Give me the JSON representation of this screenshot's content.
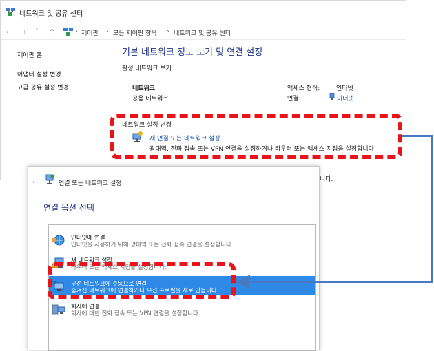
{
  "window1": {
    "title": "네트워크 및 공유 센터",
    "nav": {
      "back": "←",
      "forward": "→",
      "recent": "˅",
      "up": "↑"
    },
    "breadcrumb": [
      "제어판",
      "모든 제어판 항목",
      "네트워크 및 공유 센터"
    ],
    "breadcrumb_sep": "›",
    "sidebar": [
      "제어판 홈",
      "어댑터 설정 변경",
      "고급 공유 설정 변경"
    ],
    "heading": "기본 네트워크 정보 보기 및 연결 설정",
    "active_networks_label": "활성 네트워크 보기",
    "network": {
      "name": "네트워크",
      "type": "공용 네트워크"
    },
    "access_type_label": "액세스 형식:",
    "access_type_value": "인터넷",
    "connection_label": "연결:",
    "connection_value": "이더넷",
    "change_settings_label": "네트워크 설정 변경",
    "new_connection_link": "새 연결 또는 네트워크 설정",
    "new_connection_desc": "광대역, 전화 접속 또는 VPN 연결을 설정하거나 라우터 또는 액세스 지점을 설정합니다",
    "partial_text": "니다."
  },
  "window2": {
    "back": "←",
    "title": "연결 또는 네트워크 설정",
    "heading": "연결 옵션 선택",
    "options": [
      {
        "title": "인터넷에 연결",
        "desc": "인터넷을 사용하기 위해 광대역 또는 전화 접속 연결을 설정합니다.",
        "icon": "globe-network-icon"
      },
      {
        "title": "새 네트워크 설정",
        "desc": "라우터 또는 액세스 지점을 설정합니다.",
        "icon": "router-setup-icon"
      },
      {
        "title": "무선 네트워크에 수동으로 연결",
        "desc": "숨겨진 네트워크에 연결하거나 무선 프로필을 새로 만듭니다.",
        "icon": "wireless-monitor-icon",
        "selected": true
      },
      {
        "title": "회사에 연결",
        "desc": "회사에 대한 전화 접속 또는 VPN 연결을 설정합니다.",
        "icon": "workplace-vpn-icon"
      }
    ]
  },
  "annotation": {
    "box_color": "#e8141c",
    "arrow_color": "#4a79c4"
  },
  "colors": {
    "link": "#1a56b4",
    "heading": "#1e3287",
    "selection": "#2e8ae6"
  }
}
